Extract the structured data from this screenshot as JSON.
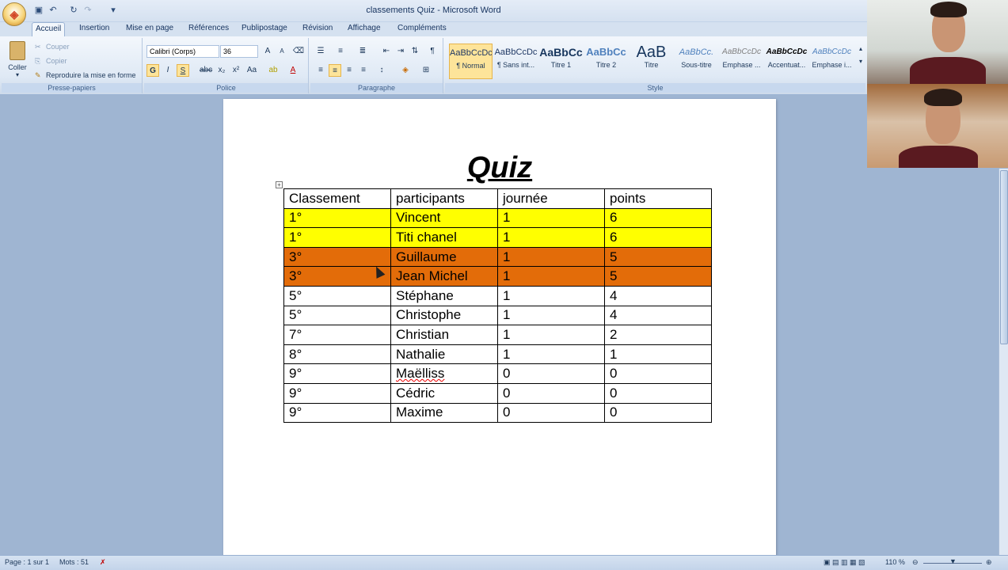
{
  "window": {
    "title": "classements Quiz - Microsoft Word"
  },
  "tabs": [
    "Accueil",
    "Insertion",
    "Mise en page",
    "Références",
    "Publipostage",
    "Révision",
    "Affichage",
    "Compléments"
  ],
  "ribbon": {
    "clipboard": {
      "paste_label": "Coller",
      "cut_label": "Couper",
      "copy_label": "Copier",
      "format_painter_label": "Reproduire la mise en forme",
      "group_label": "Presse-papiers"
    },
    "font": {
      "font_name": "Calibri (Corps)",
      "font_size": "36",
      "group_label": "Police"
    },
    "paragraph": {
      "group_label": "Paragraphe"
    },
    "styles": {
      "group_label": "Style",
      "items": [
        {
          "sample": "AaBbCcDc",
          "name": "¶ Normal"
        },
        {
          "sample": "AaBbCcDc",
          "name": "¶ Sans int..."
        },
        {
          "sample": "AaBbCc",
          "name": "Titre 1"
        },
        {
          "sample": "AaBbCc",
          "name": "Titre 2"
        },
        {
          "sample": "AaB",
          "name": "Titre"
        },
        {
          "sample": "AaBbCc.",
          "name": "Sous-titre"
        },
        {
          "sample": "AaBbCcDc",
          "name": "Emphase ..."
        },
        {
          "sample": "AaBbCcDc",
          "name": "Accentuat..."
        },
        {
          "sample": "AaBbCcDc",
          "name": "Emphase i..."
        }
      ]
    }
  },
  "document": {
    "title": "Quiz",
    "table": {
      "headers": [
        "Classement",
        "participants",
        "journée",
        "points"
      ],
      "rows": [
        {
          "rank": "1°",
          "name": "Vincent",
          "day": "1",
          "points": "6",
          "highlight": "#ffff00"
        },
        {
          "rank": "1°",
          "name": "Titi chanel",
          "day": "1",
          "points": "6",
          "highlight": "#ffff00"
        },
        {
          "rank": "3°",
          "name": "Guillaume",
          "day": "1",
          "points": "5",
          "highlight": "#e36c09"
        },
        {
          "rank": "3°",
          "name": "Jean Michel",
          "day": "1",
          "points": "5",
          "highlight": "#e36c09"
        },
        {
          "rank": "5°",
          "name": "Stéphane",
          "day": "1",
          "points": "4",
          "highlight": ""
        },
        {
          "rank": "5°",
          "name": "Christophe",
          "day": "1",
          "points": "4",
          "highlight": ""
        },
        {
          "rank": "7°",
          "name": "Christian",
          "day": "1",
          "points": "2",
          "highlight": ""
        },
        {
          "rank": "8°",
          "name": "Nathalie",
          "day": "1",
          "points": "1",
          "highlight": ""
        },
        {
          "rank": "9°",
          "name": "Maëlliss",
          "day": "0",
          "points": "0",
          "highlight": ""
        },
        {
          "rank": "9°",
          "name": "Cédric",
          "day": "0",
          "points": "0",
          "highlight": ""
        },
        {
          "rank": "9°",
          "name": "Maxime",
          "day": "0",
          "points": "0",
          "highlight": ""
        }
      ]
    }
  },
  "statusbar": {
    "page": "Page : 1 sur 1",
    "words": "Mots : 51",
    "zoom": "110 %"
  }
}
